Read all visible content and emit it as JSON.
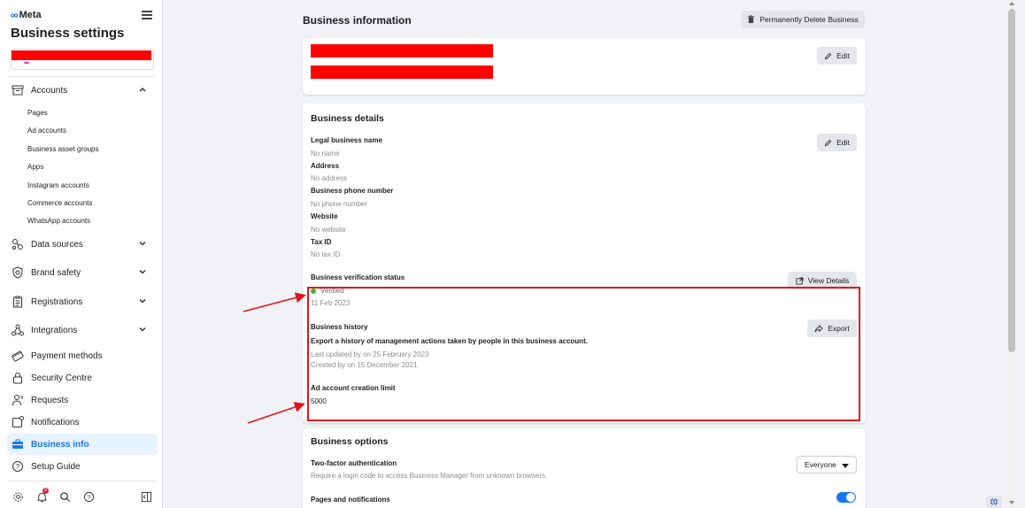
{
  "sidebar": {
    "logo": "Meta",
    "title": "Business settings",
    "accounts_section": {
      "label": "Accounts",
      "items": [
        {
          "label": "Pages"
        },
        {
          "label": "Ad accounts"
        },
        {
          "label": "Business asset groups"
        },
        {
          "label": "Apps"
        },
        {
          "label": "Instagram accounts"
        },
        {
          "label": "Commerce accounts"
        },
        {
          "label": "WhatsApp accounts"
        }
      ]
    },
    "nav": {
      "data_sources": "Data sources",
      "brand_safety": "Brand safety",
      "registrations": "Registrations",
      "integrations": "Integrations",
      "payment_methods": "Payment methods",
      "security_centre": "Security Centre",
      "requests": "Requests",
      "notifications": "Notifications",
      "business_info": "Business info",
      "setup_guide": "Setup Guide"
    },
    "notification_count": "9"
  },
  "main": {
    "page_title": "Business information",
    "delete_button": "Permanently Delete Business",
    "edit_label": "Edit",
    "business_details": {
      "title": "Business details",
      "fields": [
        {
          "label": "Legal business name",
          "value": "No name"
        },
        {
          "label": "Address",
          "value": "No address"
        },
        {
          "label": "Business phone number",
          "value": "No phone number"
        },
        {
          "label": "Website",
          "value": "No website"
        },
        {
          "label": "Tax ID",
          "value": "No tax ID"
        }
      ],
      "verification": {
        "label": "Business verification status",
        "status": "Verified",
        "date": "11 Feb 2023",
        "view_details": "View Details"
      },
      "history": {
        "label": "Business history",
        "description": "Export a history of management actions taken by people in this business account.",
        "last_updated": "Last updated by on 25 February 2023",
        "created": "Created by on 15 December 2021",
        "export_button": "Export"
      },
      "ad_limit": {
        "label": "Ad account creation limit",
        "value": "5000"
      }
    },
    "business_options": {
      "title": "Business options",
      "two_factor": {
        "label": "Two-factor authentication",
        "description": "Require a login code to access Business Manager from unknown browsers.",
        "selected": "Everyone"
      },
      "pages_notifications": {
        "label": "Pages and notifications",
        "enabled": true
      }
    }
  },
  "colors": {
    "accent": "#1877f2",
    "annotation": "#e0141e",
    "redaction": "#ff0000",
    "verified": "#42b72a"
  }
}
